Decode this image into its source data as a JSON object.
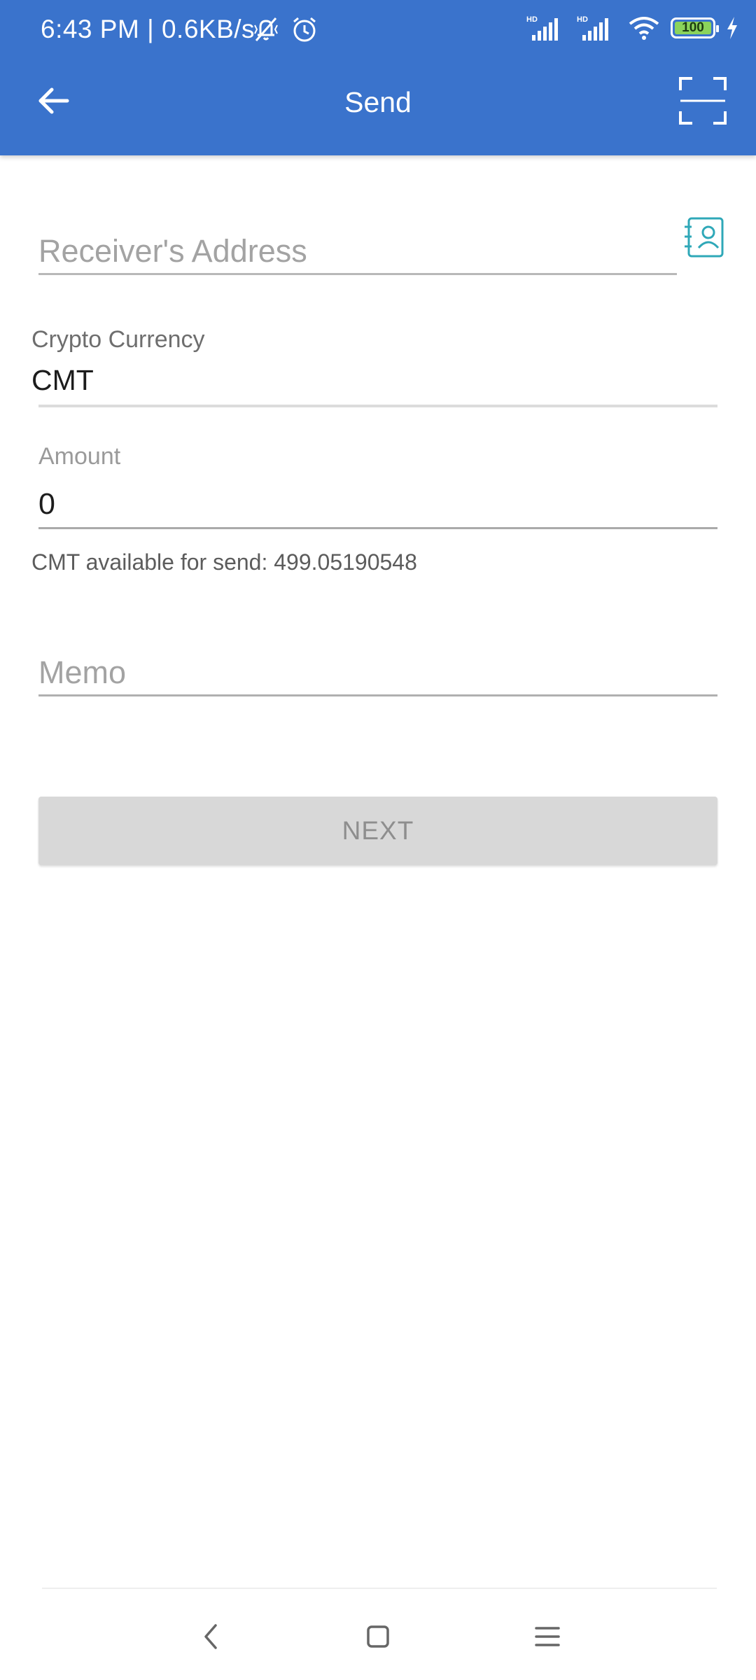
{
  "status_bar": {
    "time_speed": "6:43 PM | 0.6KB/s",
    "icons_left": [
      "vibrate-off-icon",
      "alarm-icon"
    ],
    "signal_labels": [
      "HD",
      "HD"
    ],
    "battery_level": "100"
  },
  "app_bar": {
    "title": "Send",
    "back_icon": "arrow-back-icon",
    "scan_icon": "scan-qr-icon"
  },
  "form": {
    "receiver": {
      "placeholder": "Receiver's Address",
      "value": ""
    },
    "crypto": {
      "label": "Crypto Currency",
      "value": "CMT"
    },
    "amount": {
      "label": "Amount",
      "value": "0"
    },
    "available": "CMT available for send: 499.05190548",
    "memo": {
      "placeholder": "Memo",
      "value": ""
    },
    "next_label": "NEXT"
  },
  "colors": {
    "primary": "#3a73cc",
    "accent": "#2fa8b8",
    "button_disabled": "#d8d8d8"
  }
}
